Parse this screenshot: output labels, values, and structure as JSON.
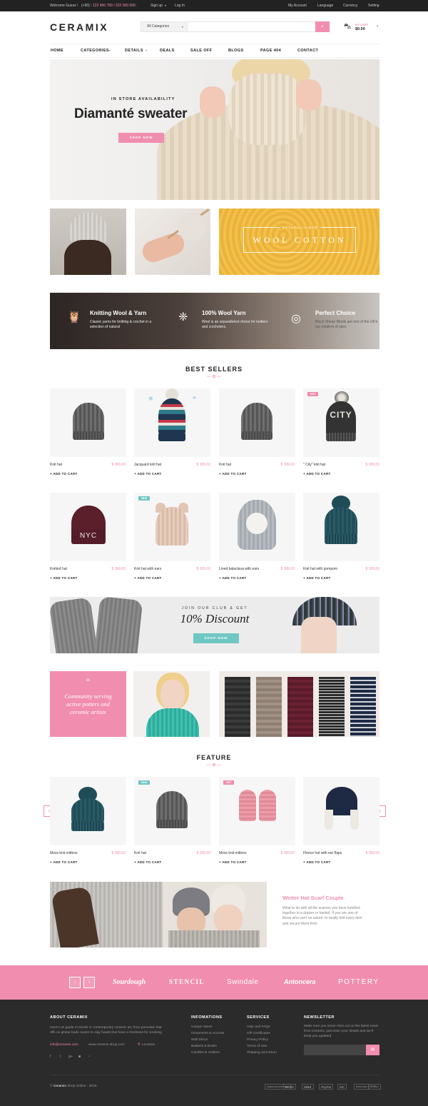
{
  "topbar": {
    "welcome": "Welcome Guess !",
    "phone_prefix": "(+00) :",
    "phone": "123 456 789 / 222 000 999 .",
    "signup": "Sign up",
    "login": "Log In",
    "account": "My Account",
    "language": "Language",
    "currency": "Currency",
    "setting": "Setting"
  },
  "header": {
    "logo": "CERAMIX",
    "search_category": "All Categories",
    "search_placeholder": "",
    "cart_label": "MY CART",
    "cart_total": "$0.00"
  },
  "nav": {
    "items": [
      "HOME",
      "CATEGORIES",
      "DETAILS",
      "DEALS",
      "SALE OFF",
      "BLOGS",
      "PAGE 404",
      "CONTACT"
    ]
  },
  "hero": {
    "subtitle": "IN STORE AVAILABILITY",
    "title": "Diamanté sweater",
    "button": "SHOP NOW"
  },
  "banner": {
    "small": "NATURAL FIBER",
    "big": "WOOL COTTON"
  },
  "features": [
    {
      "title": "Knitting Wool & Yarn",
      "desc": "Classic yarns for knitting & crochet in a selection of natural",
      "icon": "owl-icon"
    },
    {
      "title": "100% Wool Yarn",
      "desc": "Wool is an unparalleled choice for knitters and crocheters.",
      "icon": "leaf-icon"
    },
    {
      "title": "Perfect Choice",
      "desc": "Black Sheep Wools are one of the UK's top retailers of yarn.",
      "icon": "yarn-icon"
    }
  ],
  "best_sellers": {
    "title": "BEST SELLERS",
    "add_label": "ADD TO CART",
    "products": [
      {
        "name": "Knit hat",
        "price": "$ 399.00",
        "badge": ""
      },
      {
        "name": "Jacquard knit hat",
        "price": "$ 399.00",
        "badge": ""
      },
      {
        "name": "Knit hat",
        "price": "$ 399.00",
        "badge": ""
      },
      {
        "name": "\" City\" knit hat",
        "price": "$ 399.00",
        "badge": "HOT"
      },
      {
        "name": "Knitted hat",
        "price": "$ 399.00",
        "badge": ""
      },
      {
        "name": "Knit hat with ears",
        "price": "$ 399.00",
        "badge": "NEW"
      },
      {
        "name": "Lined balaclava with ears",
        "price": "$ 399.00",
        "badge": ""
      },
      {
        "name": "Knit hat with pompom",
        "price": "$ 399.00",
        "badge": ""
      }
    ],
    "hat_texts": {
      "city": "CITY",
      "nyc": "NYC"
    }
  },
  "discount": {
    "join": "JOIN OUR CLUB & GET",
    "percent": "10% Discount",
    "button": "SHOP NOW"
  },
  "quote": {
    "mark": "“",
    "text": "Community serving active potters and ceramic artists"
  },
  "feature": {
    "title": "FEATURE",
    "add_label": "ADD TO CART",
    "products": [
      {
        "name": "Moss knit mittens",
        "price": "$ 399.00",
        "badge": ""
      },
      {
        "name": "Knit hat",
        "price": "$ 399.00",
        "badge": "NEW"
      },
      {
        "name": "Moss knit mittens",
        "price": "$ 399.00",
        "badge": "HOT"
      },
      {
        "name": "Fleece hat with ear flaps",
        "price": "$ 399.00",
        "badge": ""
      }
    ]
  },
  "blog": {
    "title": "Winter Hat Scarf Couple",
    "text": "What to do with all the scarves you have tumbled together in a drawer or basket. If you are one of those who can't be asked, to neatly fold every item and secure them from"
  },
  "brands": [
    "Sourdough",
    "STENCIL",
    "Swindale",
    "Antoncera",
    "POTTERY"
  ],
  "footer": {
    "about_title": "ABOUT CERAMIX",
    "about_text": "Here's an guide to trends in contemporary ceramic art, from porcelain that riffs on global trade routes to clay heads that have a fondness for smoking",
    "email": "info@ceramix.com",
    "site": "www.ceramix-shop.com",
    "location": "Location",
    "info_title": "INFOMATIONS",
    "info_links": [
      "Unique Vases",
      "Ornaments & Accents",
      "Wall Décor",
      "Baskets & Bowls",
      "Candles & Holders"
    ],
    "services_title": "SERVICES",
    "services_links": [
      "Help and FAQs",
      "Gift Certificates",
      "Privacy Policy",
      "Terms of Use",
      "Shipping and return"
    ],
    "newsletter_title": "NEWSLETTER",
    "newsletter_text": "Make sure you never miss out on the latest news from Ceramix, just enter your details and we'll keep you updated",
    "copyright_pre": "© ",
    "copyright_brand": "Ceramix",
    "copyright_post": " Shop Online - 2016.",
    "payments": [
      "AMERICAN EXPRESS",
      "BANK",
      "VISA",
      "PayPal",
      "MC",
      "DISCOVER",
      "SKRILL"
    ]
  },
  "colors": {
    "accent": "#f18daf",
    "teal": "#6fc7c4",
    "footer": "#2b2b2b"
  }
}
